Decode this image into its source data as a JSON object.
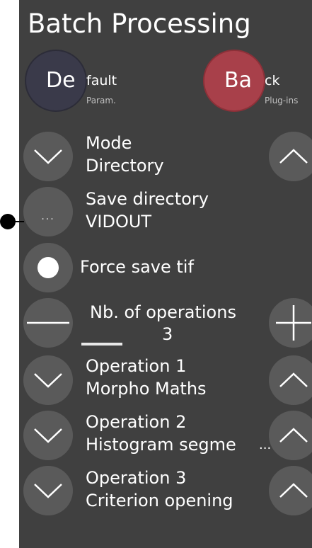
{
  "title": "Batch Processing",
  "presets": {
    "default": {
      "icon_text": "De",
      "rest_text": "fault",
      "sub": "Param.",
      "color": "#3a3a4a"
    },
    "back": {
      "icon_text": "Ba",
      "rest_text": "ck",
      "sub": "Plug-ins",
      "color": "#a8404a"
    }
  },
  "rows": {
    "mode": {
      "label": "Mode",
      "value": "Directory"
    },
    "save_dir": {
      "label": "Save directory",
      "value": "VIDOUT",
      "button": "..."
    },
    "force": {
      "label": "Force save tif"
    },
    "nb_ops": {
      "label": "Nb. of operations",
      "value": "3",
      "fraction": 0.3
    },
    "op1": {
      "label": "Operation 1",
      "value": "Morpho Maths"
    },
    "op2": {
      "label": "Operation 2",
      "value": "Histogram segme",
      "overflow": "..."
    },
    "op3": {
      "label": "Operation 3",
      "value": "Criterion opening"
    }
  },
  "icons": {
    "down": "chevron-down-icon",
    "up": "chevron-up-icon",
    "minus": "minus-icon",
    "plus": "plus-icon",
    "radio": "radio-selected-icon"
  }
}
